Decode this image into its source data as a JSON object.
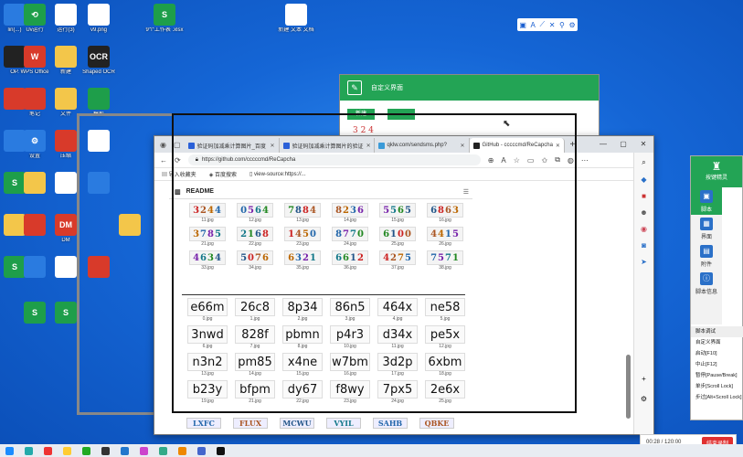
{
  "desktop": {
    "icons": [
      {
        "label": "lin(...)",
        "kind": "blue",
        "glyph": ""
      },
      {
        "label": "Uv运行",
        "kind": "xls",
        "glyph": "⟲"
      },
      {
        "label": "运行(3)",
        "kind": "doc",
        "glyph": ""
      },
      {
        "label": "v9.png",
        "kind": "doc",
        "glyph": ""
      },
      {
        "label": "9个工作表\n.xlsx",
        "kind": "xls",
        "glyph": "S"
      },
      {
        "label": "新建 文本\n文档",
        "kind": "doc",
        "glyph": ""
      },
      {
        "label": "OP.",
        "kind": "dark",
        "glyph": ""
      },
      {
        "label": "WPS Office",
        "kind": "red",
        "glyph": "W"
      },
      {
        "label": "新建",
        "kind": "folder",
        "glyph": ""
      },
      {
        "label": "Shaped OCR",
        "kind": "dark",
        "glyph": "OCR"
      },
      {
        "label": "",
        "kind": "red",
        "glyph": ""
      },
      {
        "label": "笔记",
        "kind": "red",
        "glyph": ""
      },
      {
        "label": "文件",
        "kind": "folder",
        "glyph": ""
      },
      {
        "label": "模板",
        "kind": "xls",
        "glyph": ""
      },
      {
        "label": "",
        "kind": "blue",
        "glyph": ""
      },
      {
        "label": "设置",
        "kind": "blue",
        "glyph": "⚙"
      },
      {
        "label": "压缩",
        "kind": "red",
        "glyph": ""
      },
      {
        "label": "",
        "kind": "doc",
        "glyph": ""
      },
      {
        "label": "",
        "kind": "xls",
        "glyph": "S"
      },
      {
        "label": "",
        "kind": "folder",
        "glyph": ""
      },
      {
        "label": "",
        "kind": "doc",
        "glyph": ""
      },
      {
        "label": "",
        "kind": "blue",
        "glyph": ""
      },
      {
        "label": "",
        "kind": "folder",
        "glyph": ""
      },
      {
        "label": "",
        "kind": "red",
        "glyph": ""
      },
      {
        "label": "DM",
        "kind": "red",
        "glyph": "DM"
      },
      {
        "label": "",
        "kind": "folder",
        "glyph": ""
      },
      {
        "label": "",
        "kind": "xls",
        "glyph": "S"
      },
      {
        "label": "",
        "kind": "blue",
        "glyph": ""
      },
      {
        "label": "",
        "kind": "doc",
        "glyph": ""
      },
      {
        "label": "",
        "kind": "red",
        "glyph": ""
      },
      {
        "label": "",
        "kind": "xls",
        "glyph": "S"
      },
      {
        "label": "",
        "kind": "xls",
        "glyph": "S"
      }
    ]
  },
  "mini_toolbar": {
    "items": [
      "▣",
      "A",
      "⟋",
      "✕",
      "⚲",
      "⚙"
    ]
  },
  "green_dialog": {
    "title": "自定义界面",
    "btn1": "新建",
    "btn2": "",
    "preview": "3 2 4"
  },
  "browser": {
    "tabs": [
      {
        "label": "验证码加减乘计算图片_百度",
        "color": "#2a60d8"
      },
      {
        "label": "验证码加减乘计算图片的验证",
        "color": "#2a60d8"
      },
      {
        "label": "qklw.com/sendsms.php?",
        "color": "#3a9ad8"
      },
      {
        "label": "GitHub - cccccmd/ReCapcha",
        "color": "#222"
      }
    ],
    "url": "https://github.com/cccccmd/ReCapcha",
    "bookmarks": [
      "导入收藏夹",
      "百度搜索",
      "view-source:https://..."
    ],
    "readme": "README",
    "captchas_row1": [
      {
        "text": "3244",
        "file": "11.jpg"
      },
      {
        "text": "0564",
        "file": "12.jpg"
      },
      {
        "text": "7884",
        "file": "13.jpg"
      },
      {
        "text": "8236",
        "file": "14.jpg"
      },
      {
        "text": "5565",
        "file": "15.jpg"
      },
      {
        "text": "6863",
        "file": "16.jpg"
      },
      {
        "text": "3785",
        "file": "21.jpg"
      },
      {
        "text": "2168",
        "file": "22.jpg"
      },
      {
        "text": "1450",
        "file": "23.jpg"
      },
      {
        "text": "8770",
        "file": "24.jpg"
      },
      {
        "text": "6100",
        "file": "25.jpg"
      },
      {
        "text": "4415",
        "file": "26.jpg"
      },
      {
        "text": "4634",
        "file": "33.jpg"
      },
      {
        "text": "5076",
        "file": "34.jpg"
      },
      {
        "text": "6321",
        "file": "35.jpg"
      },
      {
        "text": "6612",
        "file": "36.jpg"
      },
      {
        "text": "4275",
        "file": "37.jpg"
      },
      {
        "text": "7571",
        "file": "38.jpg"
      }
    ],
    "captchas_row2": [
      {
        "text": "e66m",
        "file": "0.jpg"
      },
      {
        "text": "26c8",
        "file": "1.jpg"
      },
      {
        "text": "8p34",
        "file": "2.jpg"
      },
      {
        "text": "86n5",
        "file": "3.jpg"
      },
      {
        "text": "464x",
        "file": "4.jpg"
      },
      {
        "text": "ne58",
        "file": "5.jpg"
      },
      {
        "text": "3nwd",
        "file": "6.jpg"
      },
      {
        "text": "828f",
        "file": "7.jpg"
      },
      {
        "text": "pbmn",
        "file": "8.jpg"
      },
      {
        "text": "p4r3",
        "file": "10.jpg"
      },
      {
        "text": "d34x",
        "file": "11.jpg"
      },
      {
        "text": "pe5x",
        "file": "12.jpg"
      },
      {
        "text": "n3n2",
        "file": "13.jpg"
      },
      {
        "text": "pm85",
        "file": "14.jpg"
      },
      {
        "text": "x4ne",
        "file": "15.jpg"
      },
      {
        "text": "w7bm",
        "file": "16.jpg"
      },
      {
        "text": "3d2p",
        "file": "17.jpg"
      },
      {
        "text": "6xbm",
        "file": "18.jpg"
      },
      {
        "text": "b23y",
        "file": "19.jpg"
      },
      {
        "text": "bfpm",
        "file": "21.jpg"
      },
      {
        "text": "dy67",
        "file": "22.jpg"
      },
      {
        "text": "f8wy",
        "file": "23.jpg"
      },
      {
        "text": "7px5",
        "file": "24.jpg"
      },
      {
        "text": "2e6x",
        "file": "25.jpg"
      }
    ],
    "captchas_row3": [
      "LXFC",
      "FLUX",
      "MCWU",
      "VYIL",
      "SAHB",
      "QBKE"
    ]
  },
  "right_panel": {
    "title": "按键精灵",
    "nav": [
      "脚本",
      "界面",
      "附件",
      "脚本信息"
    ],
    "section": "脚本调试",
    "items": [
      "自定义界面",
      "启动[F10]",
      "中止[F12]",
      "暂停[Pause/Break]",
      "单步[Scroll Lock]",
      "步过[Alt+Scroll Lock]"
    ]
  },
  "recorder": {
    "time": "00:28 / 120:00",
    "stop": "结束录制"
  }
}
